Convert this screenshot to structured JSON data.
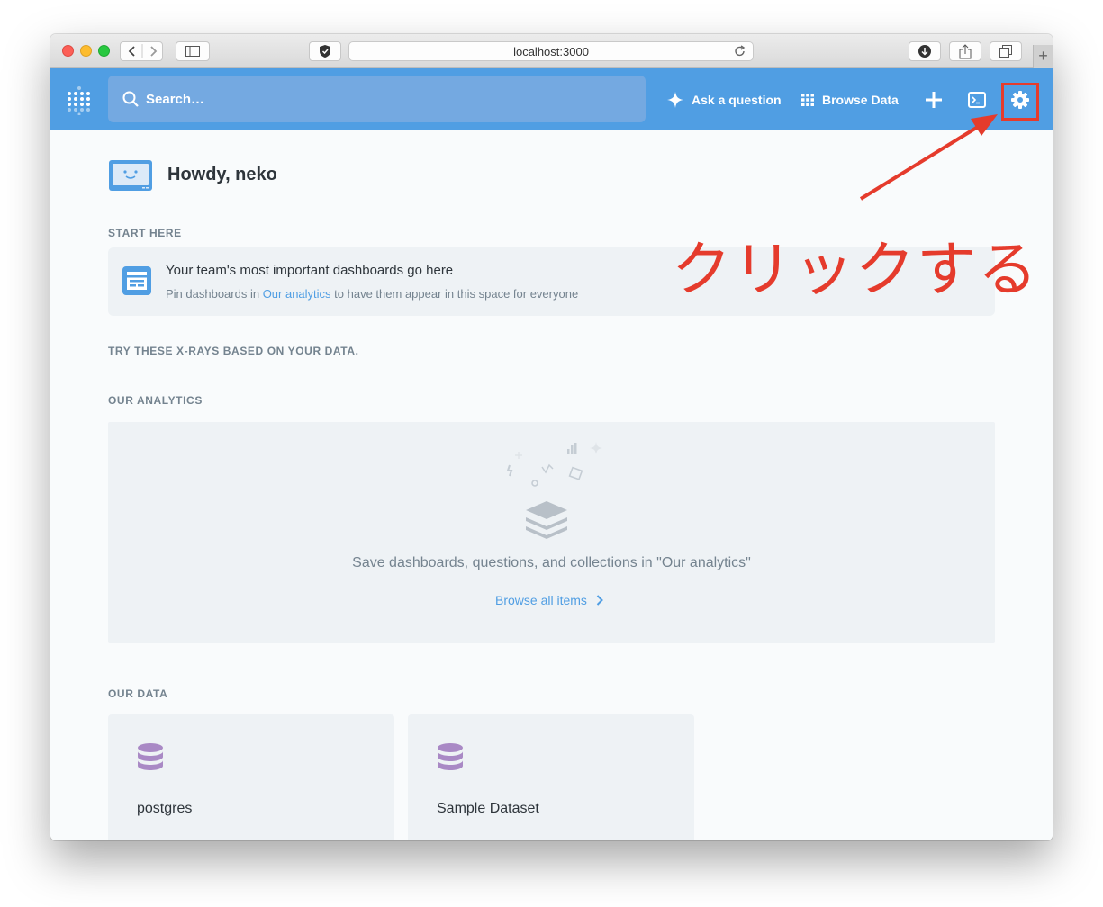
{
  "browser": {
    "url": "localhost:3000",
    "new_tab_symbol": "+"
  },
  "nav": {
    "search_placeholder": "Search…",
    "ask_question": "Ask a question",
    "browse_data": "Browse Data",
    "icons": [
      "metabase-logo-icon",
      "search-icon",
      "sparkle-icon",
      "grid-icon",
      "plus-icon",
      "terminal-icon",
      "gear-icon"
    ]
  },
  "home": {
    "greeting": "Howdy, neko",
    "start_here_label": "START HERE",
    "pin_title": "Your team's most important dashboards go here",
    "pin_sub_before": "Pin dashboards in ",
    "pin_sub_link": "Our analytics",
    "pin_sub_after": " to have them appear in this space for everyone",
    "xrays_label": "TRY THESE X-RAYS BASED ON YOUR DATA.",
    "our_analytics_label": "OUR ANALYTICS",
    "empty_message": "Save dashboards, questions, and collections in \"Our analytics\"",
    "browse_all": "Browse all items",
    "our_data_label": "OUR DATA",
    "databases": [
      {
        "name": "postgres"
      },
      {
        "name": "Sample Dataset"
      }
    ]
  },
  "annotation": {
    "text": "クリックする",
    "color": "#e53b2c"
  },
  "colors": {
    "brand": "#509ee3",
    "database_icon": "#a989c5"
  }
}
